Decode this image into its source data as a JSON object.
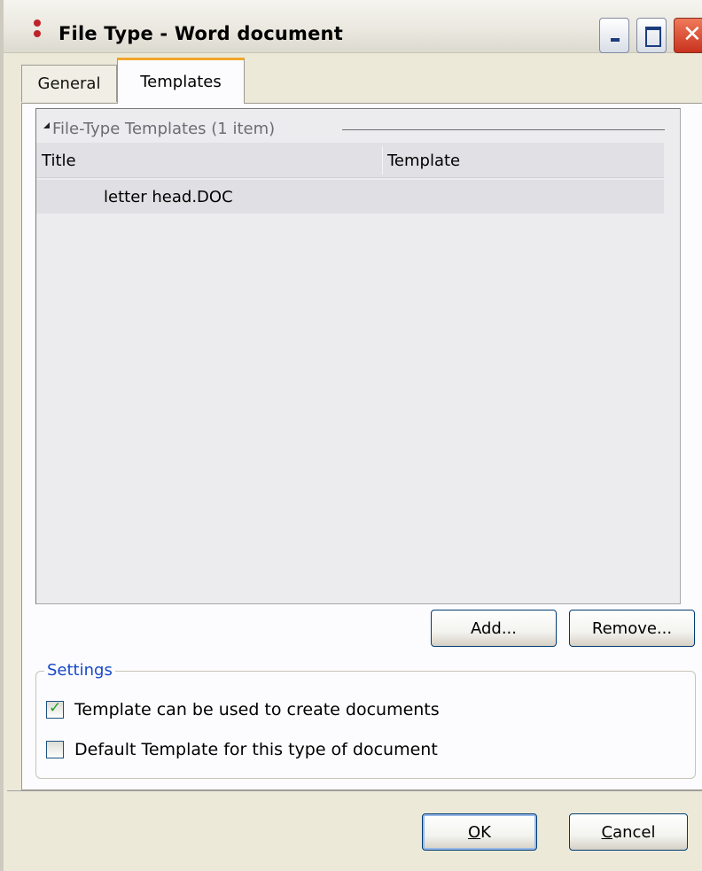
{
  "window": {
    "title": "File Type - Word document"
  },
  "tabs": [
    {
      "label": "General",
      "selected": false
    },
    {
      "label": "Templates",
      "selected": true
    }
  ],
  "list": {
    "group_header": "File-Type Templates (1 item)",
    "columns": [
      "Title",
      "Template"
    ],
    "rows": [
      {
        "title": "letter head.DOC",
        "template": ""
      }
    ]
  },
  "list_buttons": {
    "add": "Add...",
    "remove": "Remove..."
  },
  "settings": {
    "legend": "Settings",
    "options": [
      {
        "label": "Template can be used to create documents",
        "checked": true
      },
      {
        "label": "Default Template for this type of document",
        "checked": false
      }
    ]
  },
  "dialog_buttons": {
    "ok_mnemonic": "O",
    "ok_rest": "K",
    "cancel_mnemonic": "C",
    "cancel_rest": "ancel"
  },
  "colors": {
    "accent_tab": "#f2a52a",
    "settings_legend": "#1848c8",
    "checkmark": "#21a121",
    "close_button": "#c8321e"
  }
}
